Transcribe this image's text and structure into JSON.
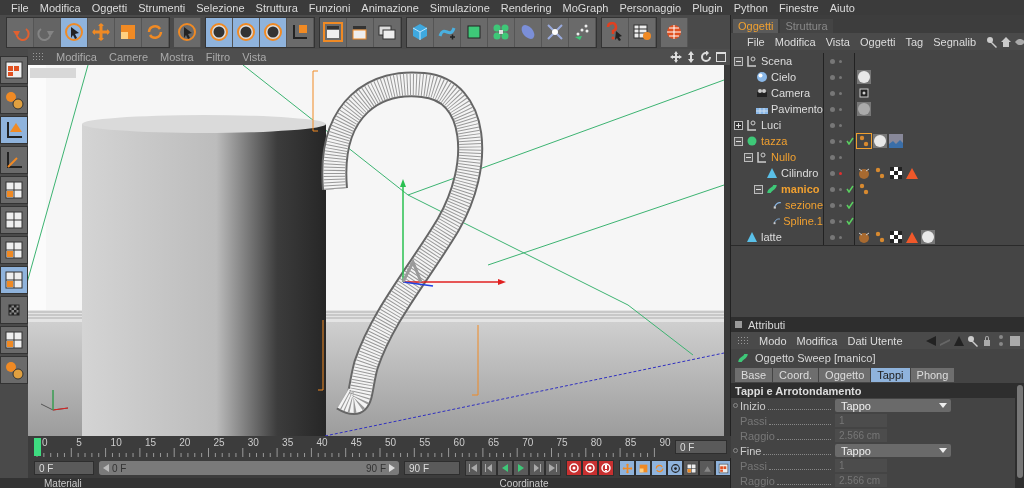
{
  "menu": [
    "File",
    "Modifica",
    "Oggetti",
    "Strumenti",
    "Selezione",
    "Struttura",
    "Funzioni",
    "Animazione",
    "Simulazione",
    "Rendering",
    "MoGraph",
    "Personaggio",
    "Plugin",
    "Python",
    "Finestre",
    "Aiuto"
  ],
  "toolbar": [
    {
      "buttons": [
        {
          "kind": "undo",
          "selected": false,
          "disabled": false
        },
        {
          "kind": "redo",
          "selected": false,
          "disabled": true
        },
        {
          "kind": "pointer",
          "selected": true,
          "disabled": false
        },
        {
          "kind": "move",
          "selected": false,
          "disabled": false
        },
        {
          "kind": "scale",
          "selected": false,
          "disabled": false
        },
        {
          "kind": "rotate",
          "selected": false,
          "disabled": false
        }
      ]
    },
    {
      "buttons": [
        {
          "kind": "pointer",
          "selected": false,
          "disabled": false
        }
      ]
    },
    {
      "buttons": [
        {
          "kind": "x",
          "selected": true,
          "disabled": false
        },
        {
          "kind": "y",
          "selected": true,
          "disabled": false
        },
        {
          "kind": "z",
          "selected": true,
          "disabled": false
        },
        {
          "kind": "axes",
          "selected": false,
          "disabled": false
        }
      ]
    },
    {
      "buttons": [
        {
          "kind": "clapper-frame",
          "selected": false,
          "disabled": false
        },
        {
          "kind": "clapper",
          "selected": false,
          "disabled": false
        },
        {
          "kind": "clapper-stack",
          "selected": false,
          "disabled": false
        }
      ]
    },
    {
      "buttons": [
        {
          "kind": "cube",
          "selected": false,
          "disabled": false
        },
        {
          "kind": "spline",
          "selected": false,
          "disabled": false
        },
        {
          "kind": "green-cube",
          "selected": false,
          "disabled": false
        },
        {
          "kind": "cluster",
          "selected": false,
          "disabled": false
        },
        {
          "kind": "lens",
          "selected": false,
          "disabled": false
        },
        {
          "kind": "burst",
          "selected": false,
          "disabled": false
        },
        {
          "kind": "dots",
          "selected": false,
          "disabled": false
        }
      ]
    },
    {
      "buttons": [
        {
          "kind": "help",
          "selected": false,
          "disabled": false
        },
        {
          "kind": "table-help",
          "selected": false,
          "disabled": false
        }
      ]
    },
    {
      "buttons": [
        {
          "kind": "globe",
          "selected": false,
          "disabled": false
        }
      ]
    }
  ],
  "left_tools": [
    {
      "kind": "layout",
      "selected": false
    },
    {
      "kind": "spheres",
      "selected": false
    },
    {
      "kind": "axis-cone",
      "selected": true
    },
    {
      "kind": "axis",
      "selected": false
    },
    {
      "kind": "grid-dots",
      "selected": false
    },
    {
      "kind": "grid",
      "selected": false
    },
    {
      "kind": "grid-orange",
      "selected": false
    },
    {
      "kind": "grid-cube",
      "selected": true
    },
    {
      "kind": "checker",
      "selected": false
    },
    {
      "kind": "axis-grid",
      "selected": false
    },
    {
      "kind": "orange-spheres",
      "selected": false
    }
  ],
  "viewport": {
    "menu": [
      "Modifica",
      "Camere",
      "Mostra",
      "Filtro",
      "Vista"
    ]
  },
  "timeline": {
    "ruler": [
      "0",
      "5",
      "10",
      "15",
      "20",
      "25",
      "30",
      "35",
      "40",
      "45",
      "50",
      "55",
      "60",
      "65",
      "70",
      "75",
      "80",
      "85",
      "90"
    ],
    "current_frame": "0 F",
    "start": "0 F",
    "range_start": "0 F",
    "range_end": "90 F",
    "level": 1,
    "end": "90 F",
    "transport": [
      {
        "kind": "first"
      },
      {
        "kind": "prev-key"
      },
      {
        "kind": "prev"
      },
      {
        "kind": "play"
      },
      {
        "kind": "next-key"
      },
      {
        "kind": "last"
      }
    ],
    "record": [
      {
        "kind": "record"
      },
      {
        "kind": "autokey"
      },
      {
        "kind": "keyhelp"
      }
    ],
    "toggles": [
      {
        "kind": "move",
        "selected": true
      },
      {
        "kind": "scale",
        "selected": true
      },
      {
        "kind": "rotate",
        "selected": true
      },
      {
        "kind": "param",
        "selected": true
      },
      {
        "kind": "grid-dots",
        "selected": false
      },
      {
        "kind": "pla",
        "selected": false
      },
      {
        "kind": "layout",
        "selected": true
      }
    ]
  },
  "bottom_panels": [
    "Materiali",
    "Coordinate"
  ],
  "objects_panel": {
    "tabs": [
      {
        "label": "Oggetti",
        "selected": true
      },
      {
        "label": "Struttura",
        "selected": false
      }
    ],
    "menu": [
      "File",
      "Modifica",
      "Vista",
      "Oggetti",
      "Tag",
      "Segnalib"
    ],
    "tree": [
      {
        "name": "Scena",
        "kind": "null",
        "expanded": true,
        "selected": false,
        "active": false,
        "checked": false,
        "render_off": false,
        "children": [
          {
            "name": "Cielo",
            "kind": "sky",
            "selected": false,
            "active": false,
            "checked": false,
            "render_off": false,
            "tags": [
              {
                "kind": "material-white",
                "selected": false
              }
            ]
          },
          {
            "name": "Camera",
            "kind": "camera",
            "selected": false,
            "active": false,
            "checked": false,
            "render_off": false,
            "tags": [
              {
                "kind": "target",
                "selected": false
              }
            ]
          },
          {
            "name": "Pavimento",
            "kind": "floor",
            "selected": false,
            "active": false,
            "checked": false,
            "render_off": false,
            "tags": [
              {
                "kind": "material-grey",
                "selected": false
              }
            ]
          }
        ]
      },
      {
        "name": "Luci",
        "kind": "null",
        "expanded": false,
        "selected": false,
        "active": false,
        "checked": false,
        "render_off": false
      },
      {
        "name": "tazza",
        "kind": "hypernurbs",
        "expanded": true,
        "selected": true,
        "active": false,
        "checked": true,
        "render_off": false,
        "tags": [
          {
            "kind": "phong",
            "selected": true
          },
          {
            "kind": "material-white",
            "selected": false
          },
          {
            "kind": "material-water",
            "selected": false
          }
        ],
        "children": [
          {
            "name": "Nullo",
            "kind": "null",
            "expanded": true,
            "selected": true,
            "active": false,
            "checked": false,
            "render_off": false,
            "children": [
              {
                "name": "Cilindro",
                "kind": "cone",
                "selected": false,
                "active": false,
                "checked": false,
                "render_off": true,
                "tags": [
                  {
                    "kind": "texture",
                    "selected": false
                  },
                  {
                    "kind": "phong",
                    "selected": false
                  },
                  {
                    "kind": "checker",
                    "selected": false
                  },
                  {
                    "kind": "triangle",
                    "selected": false
                  }
                ]
              },
              {
                "name": "manico",
                "kind": "sweep",
                "expanded": true,
                "selected": true,
                "active": true,
                "checked": true,
                "render_off": false,
                "tags": [
                  {
                    "kind": "phong",
                    "selected": false
                  }
                ],
                "children": [
                  {
                    "name": "sezione",
                    "kind": "spline",
                    "selected": true,
                    "active": false,
                    "checked": true,
                    "render_off": false
                  },
                  {
                    "name": "Spline.1",
                    "kind": "spline",
                    "selected": true,
                    "active": false,
                    "checked": true,
                    "render_off": false
                  }
                ]
              }
            ]
          }
        ]
      },
      {
        "name": "latte",
        "kind": "cone",
        "selected": false,
        "active": false,
        "checked": false,
        "render_off": false,
        "tags": [
          {
            "kind": "texture",
            "selected": false
          },
          {
            "kind": "phong",
            "selected": false
          },
          {
            "kind": "checker",
            "selected": false
          },
          {
            "kind": "triangle",
            "selected": false
          },
          {
            "kind": "material-white",
            "selected": false
          }
        ]
      }
    ]
  },
  "attributes": {
    "title": "Attributi",
    "menu": [
      "Modo",
      "Modifica",
      "Dati Utente"
    ],
    "object_title": "Oggetto Sweep [manico]",
    "tabs": [
      {
        "label": "Base",
        "selected": false
      },
      {
        "label": "Coord.",
        "selected": false
      },
      {
        "label": "Oggetto",
        "selected": false
      },
      {
        "label": "Tappi",
        "selected": true
      },
      {
        "label": "Phong",
        "selected": false
      }
    ],
    "section": "Tappi e Arrotondamento",
    "fields": [
      {
        "label": "Inizio",
        "kind": "dropdown",
        "value": "Tappo",
        "disabled": false
      },
      {
        "label": "Passi",
        "kind": "number",
        "value": "1",
        "disabled": true
      },
      {
        "label": "Raggio",
        "kind": "number",
        "value": "2.566 cm",
        "disabled": true
      },
      {
        "label": "Fine",
        "kind": "dropdown",
        "value": "Tappo",
        "disabled": false
      },
      {
        "label": "Passi",
        "kind": "number",
        "value": "1",
        "disabled": true
      },
      {
        "label": "Raggio",
        "kind": "number",
        "value": "2.566 cm",
        "disabled": true
      }
    ]
  }
}
